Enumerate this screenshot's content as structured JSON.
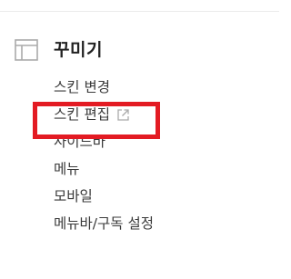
{
  "section": {
    "icon": "layout-icon",
    "title": "꾸미기"
  },
  "menu": {
    "items": [
      {
        "label": "스킨 변경"
      },
      {
        "label": "스킨 편집",
        "icon": "external-link-icon"
      },
      {
        "label": "사이드바"
      },
      {
        "label": "메뉴"
      },
      {
        "label": "모바일"
      },
      {
        "label": "메뉴바/구독 설정"
      }
    ]
  },
  "highlight": {
    "target": "스킨 편집",
    "color": "#e31b23"
  },
  "colors": {
    "text": "#3a3a3a",
    "title": "#222222",
    "icon": "#aaaaaa",
    "divider": "#ebebeb"
  }
}
